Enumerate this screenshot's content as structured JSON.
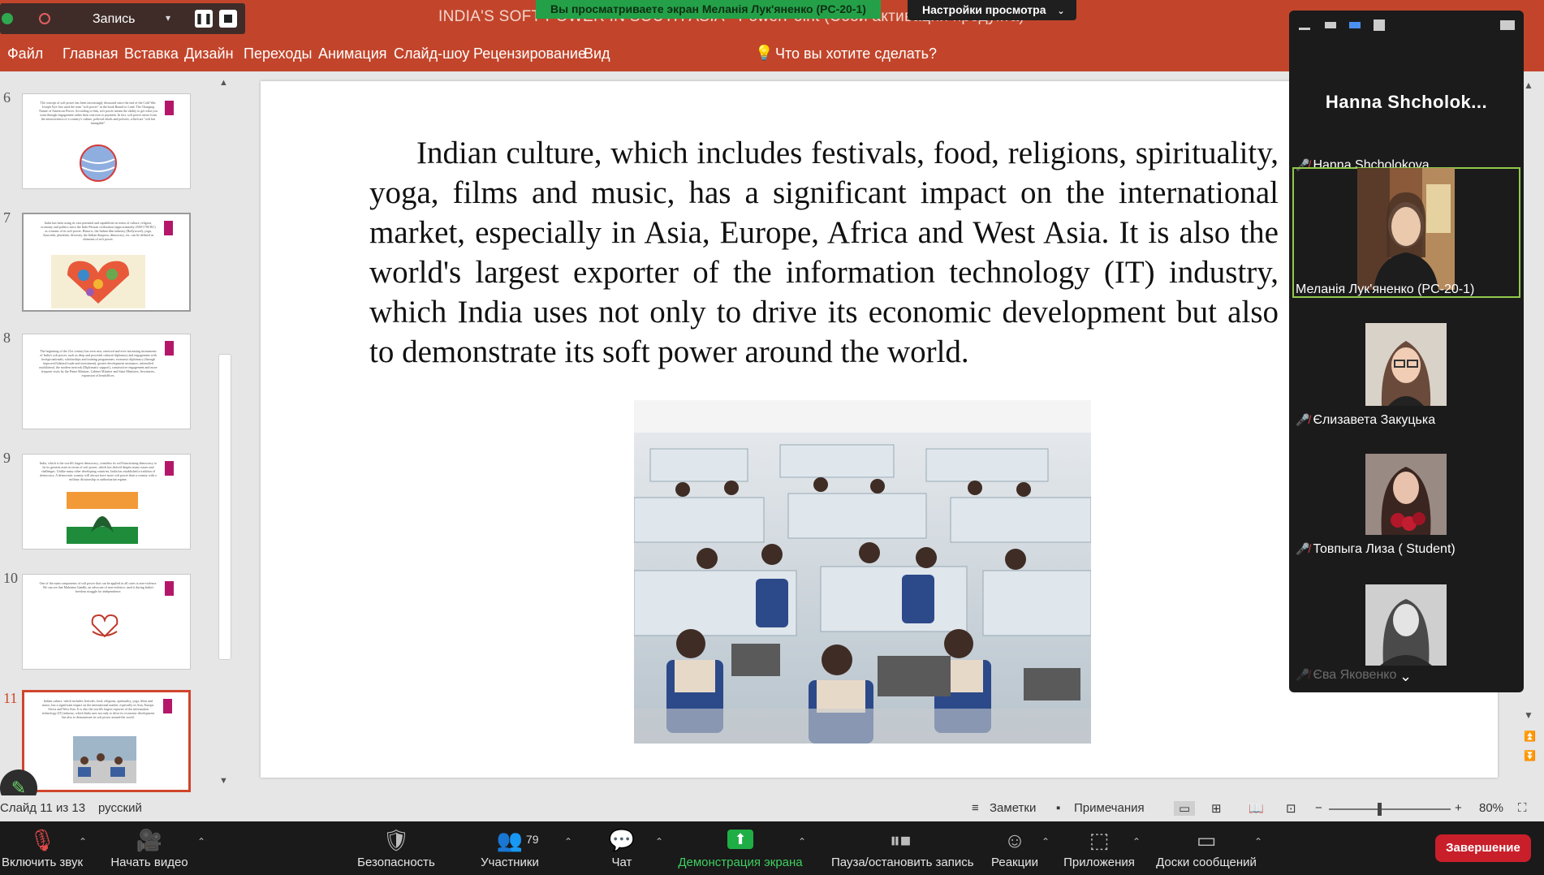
{
  "recording": {
    "label": "Запись",
    "caret": "▾"
  },
  "share_banner": "Вы просматриваете экран Меланія Лук'яненко (PC-20-1)",
  "view_options": "Настройки просмотра",
  "doc_title": "INDIA'S SOFT POWER IN SOUTH ASIA - PowerPoint (Сбой активации продукта)",
  "ribbon": {
    "tabs": [
      "Файл",
      "Главная",
      "Вставка",
      "Дизайн",
      "Переходы",
      "Анимация",
      "Слайд-шоу",
      "Рецензирование",
      "Вид"
    ],
    "tell_me": "Что вы хотите сделать?"
  },
  "thumbnails": {
    "numbers": [
      "6",
      "7",
      "8",
      "9",
      "10",
      "11"
    ],
    "texts": [
      "The concept of soft power has been increasingly discussed since the end of the Cold War. Joseph Nye first used the term \"soft power\" in the book Bound to Lead: The Changing Nature of American Power. According to him, soft power means the ability to get what you want through engagement rather than coercion or payment. In fact, soft power arises from the attractiveness of a country's culture, political ideals and policies, which are \"soft but intangible\".",
      "India has been using its vast potential and capabilities in terms of culture, religion, economy and politics since the Indo-Persian civilization (approximately 2500-1700 BC) as a means of its soft power. Historic, the Indian film industry (Bollywood), yoga, Ayurveda, pluralistic diversity, the Indian diaspora, democracy, etc. can be defined as elements of soft power.",
      "The beginning of the 21st century has seen new, renewed and ever-increasing instruments of India's soft power, such as deep and powerful cultural diplomacy and engagement with foreign nationals, scholarships and training programmes, economic diplomacy (through improved bilateral trade and investment), greater development assistance, intensified multilateral, the modern network (Diplomatic support), constructive engagement and more frequent visits by the Prime Minister, Cabinet Minister and State Ministers, Secretaries, expansion of headoffices.",
      "India, which is the world's largest democracy, considers its well-functioning democracy to be its greatest asset in terms of soft power, which has thrived despite many issues and challenges. Unlike many other developing countries, India has established a tradition of democracy. A democratic country will always have more soft power than a country with a military dictatorship or authoritarian regime.",
      "One of the main components of soft power that can be applied in all cases is non-violence. We can see that Mahatma Gandhi, an advocate of non-violence, used it during India's freedom struggle for independence.",
      "Indian culture, which includes festivals, food, religions, spirituality, yoga, films and music, has a significant impact on the international market, especially in Asia, Europe, Africa and West Asia. It is also the world's largest exporter of the information technology (IT) industry, which India uses not only to drive its economic development but also to demonstrate its soft power around the world."
    ]
  },
  "slide": {
    "text": "Indian culture, which includes festivals, food, religions, spirituality, yoga, films and music, has a significant impact on the international market, especially in Asia, Europe, Africa and West Asia. It is also the world's largest exporter of the information technology (IT) industry, which India uses not only to drive its economic development but also to demonstrate its soft power around the world."
  },
  "gallery": {
    "host_name": "Hanna Shcholok...",
    "participants": [
      {
        "name": "Hanna Shcholokova",
        "muted": true
      },
      {
        "name": "Меланія Лук'яненко (PC-20-1)",
        "muted": false
      },
      {
        "name": "Єлизавета Закуцька",
        "muted": true
      },
      {
        "name": "Товпыга Лиза ( Student)",
        "muted": true
      },
      {
        "name": "Єва Яковенко",
        "muted": true
      }
    ]
  },
  "statusbar": {
    "slide_info": "Слайд 11 из 13",
    "language": "русский",
    "notes": "Заметки",
    "comments": "Примечания",
    "zoom": "80%"
  },
  "zoom_toolbar": {
    "mute": "Включить звук",
    "video": "Начать видео",
    "security": "Безопасность",
    "participants": "Участники",
    "participants_count": "79",
    "chat": "Чат",
    "share": "Демонстрация экрана",
    "record": "Пауза/остановить запись",
    "reactions": "Реакции",
    "apps": "Приложения",
    "whiteboard": "Доски сообщений",
    "end": "Завершение"
  },
  "colors": {
    "ribbon": "#c2452b",
    "accent_mark": "#b4176a",
    "share_green": "#24a148",
    "end_red": "#c81f2a"
  }
}
